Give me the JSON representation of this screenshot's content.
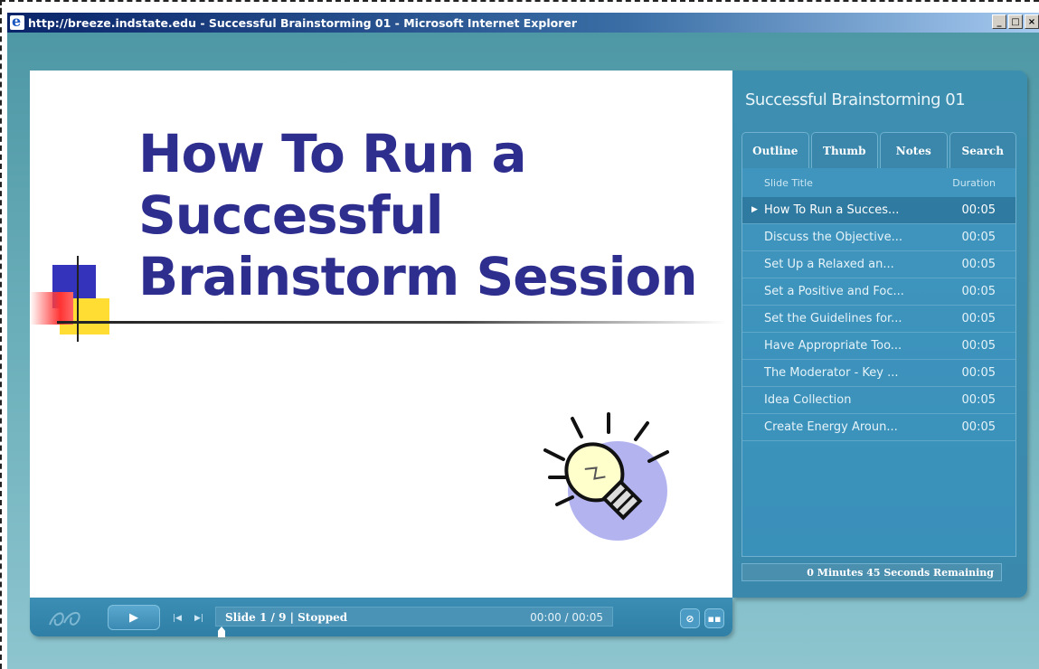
{
  "window": {
    "title": "http://breeze.indstate.edu - Successful Brainstorming 01 - Microsoft Internet Explorer",
    "buttons": {
      "minimize": "_",
      "maximize": "□",
      "close": "×"
    }
  },
  "slide": {
    "title": "How To Run a Successful Brainstorm Session"
  },
  "panel": {
    "title": "Successful Brainstorming 01",
    "tabs": [
      "Outline",
      "Thumb",
      "Notes",
      "Search"
    ],
    "active_tab": "Outline",
    "header_title": "Slide Title",
    "header_duration": "Duration",
    "rows": [
      {
        "title": "How To Run a Succes...",
        "duration": "00:05",
        "active": true
      },
      {
        "title": "Discuss the Objective...",
        "duration": "00:05"
      },
      {
        "title": "Set Up a Relaxed  an...",
        "duration": "00:05"
      },
      {
        "title": "Set a Positive and Foc...",
        "duration": "00:05"
      },
      {
        "title": "Set the Guidelines for...",
        "duration": "00:05"
      },
      {
        "title": "Have Appropriate Too...",
        "duration": "00:05"
      },
      {
        "title": "The Moderator -  Key ...",
        "duration": "00:05"
      },
      {
        "title": "Idea Collection",
        "duration": "00:05"
      },
      {
        "title": "Create Energy Aroun...",
        "duration": "00:05"
      }
    ],
    "remaining": "0 Minutes 45 Seconds Remaining"
  },
  "controls": {
    "status": "Slide 1 / 9 | Stopped",
    "time": "00:00 / 00:05",
    "progress_fraction": 0.0,
    "icons": [
      "play-icon",
      "skip-back-icon",
      "skip-forward-icon",
      "attachment-icon",
      "presenter-info-icon"
    ]
  }
}
